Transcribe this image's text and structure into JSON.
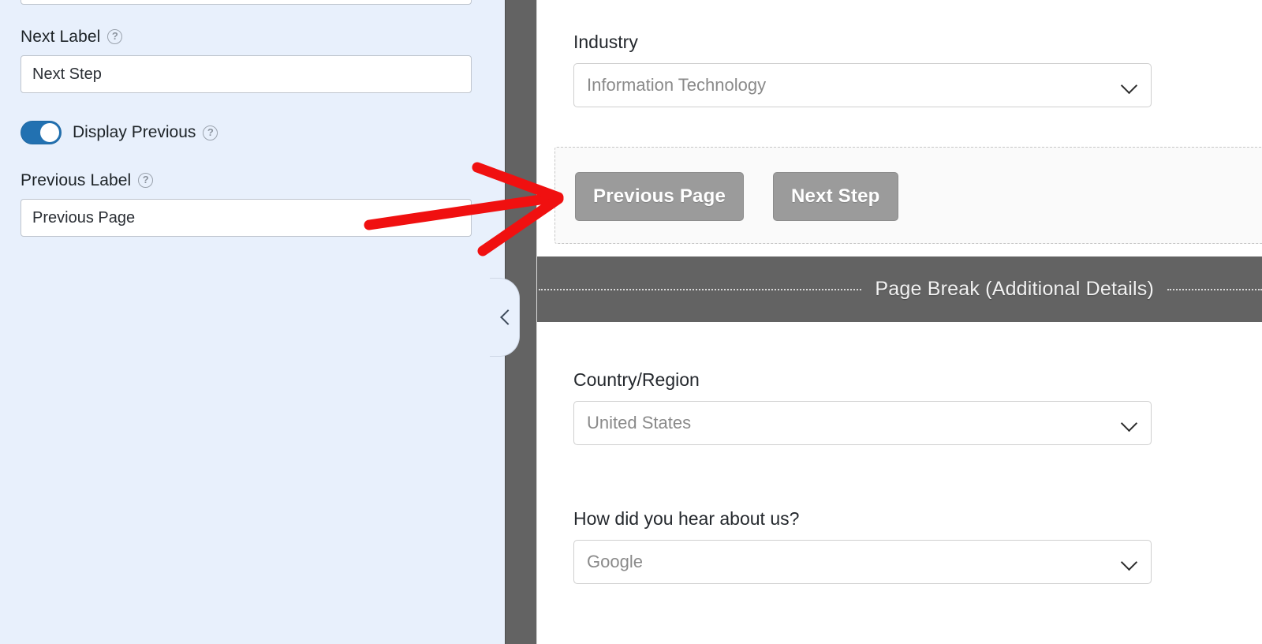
{
  "settings_panel": {
    "clipped_field_above": {
      "name": "partial-input-above"
    },
    "next_label": {
      "label": "Next Label",
      "help_icon": "help-circle-icon",
      "value": "Next Step",
      "placeholder": "Next Step"
    },
    "display_previous": {
      "label": "Display Previous",
      "help_icon": "help-circle-icon",
      "state": "on",
      "accent_color": "#2271b1"
    },
    "previous_label": {
      "label": "Previous Label",
      "help_icon": "help-circle-icon",
      "value": "Previous Page",
      "placeholder": "Previous Page"
    },
    "background_color": "#e8f0fc"
  },
  "collapse_handle": {
    "icon": "chevron-left-icon",
    "tooltip": "Collapse panel"
  },
  "gutter": {
    "color": "#636363"
  },
  "form_preview": {
    "fields": [
      {
        "label": "Industry",
        "type": "select",
        "value": "Information Technology",
        "chevron": "chevron-down-icon"
      },
      {
        "label": "Country/Region",
        "type": "select",
        "value": "United States",
        "chevron": "chevron-down-icon"
      },
      {
        "label": "How did you hear about us?",
        "type": "select",
        "value": "Google",
        "chevron": "chevron-down-icon"
      }
    ],
    "page_nav": {
      "previous_button": "Previous Page",
      "next_button": "Next Step",
      "button_color": "#9b9b9b"
    },
    "page_break_bar": {
      "text": "Page Break (Additional Details)",
      "bar_color": "#636363"
    }
  },
  "annotation": {
    "arrow_color": "#f01010",
    "points_to": "Previous Page button"
  }
}
